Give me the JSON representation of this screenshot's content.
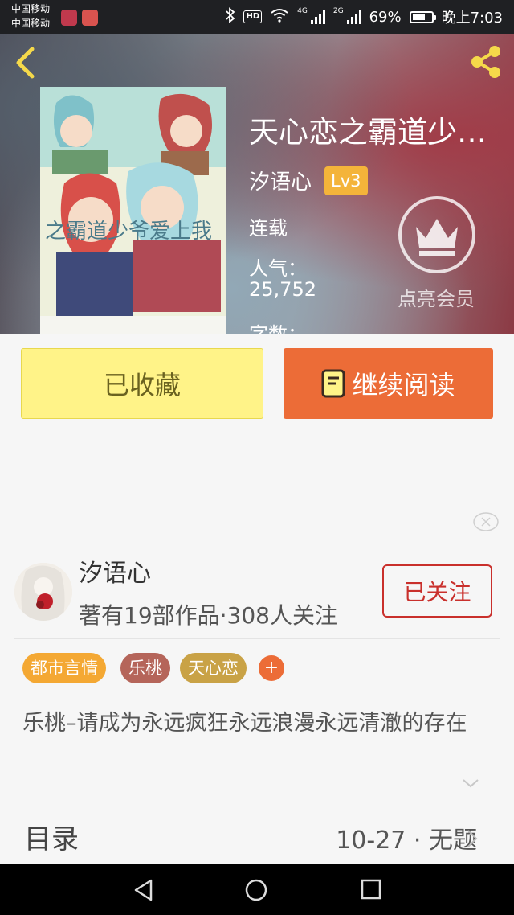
{
  "status_bar": {
    "carrier_1": "中国移动",
    "carrier_2": "中国移动",
    "hd_label": "HD",
    "network_1": "4G",
    "network_2": "2G",
    "battery_text": "69%",
    "battery_level": 0.69,
    "time": "晚上7:03"
  },
  "header": {
    "back_icon": "chevron-left-icon",
    "share_icon": "share-icon",
    "cover_text": "之霸道少爷爱上我",
    "title": "天心恋之霸道少…",
    "author": "汐语心",
    "level": "Lv3",
    "status": "连载",
    "popularity_label": "人气：",
    "popularity_value": "25,752",
    "word_count_label": "字数：",
    "vip_icon": "crown-icon",
    "vip_label": "点亮会员"
  },
  "actions": {
    "favorite_label": "已收藏",
    "read_icon": "book-icon",
    "read_label": "继续阅读"
  },
  "author_card": {
    "name": "汐语心",
    "meta": "著有19部作品·308人关注",
    "follow_label": "已关注"
  },
  "tags": [
    {
      "label": "都市言情",
      "color": "#f4a833"
    },
    {
      "label": "乐桃",
      "color": "#b5655a"
    },
    {
      "label": "天心恋",
      "color": "#c9a246"
    }
  ],
  "tag_add_label": "+",
  "description": "乐桃–请成为永远疯狂永远浪漫永远清澈的存在",
  "toc": {
    "label": "目录",
    "latest": "10-27 · 无题"
  },
  "colors": {
    "accent_orange": "#ec6c37",
    "accent_yellow": "#fff388",
    "follow_red": "#c9302c",
    "icon_yellow": "#f5d94a"
  }
}
